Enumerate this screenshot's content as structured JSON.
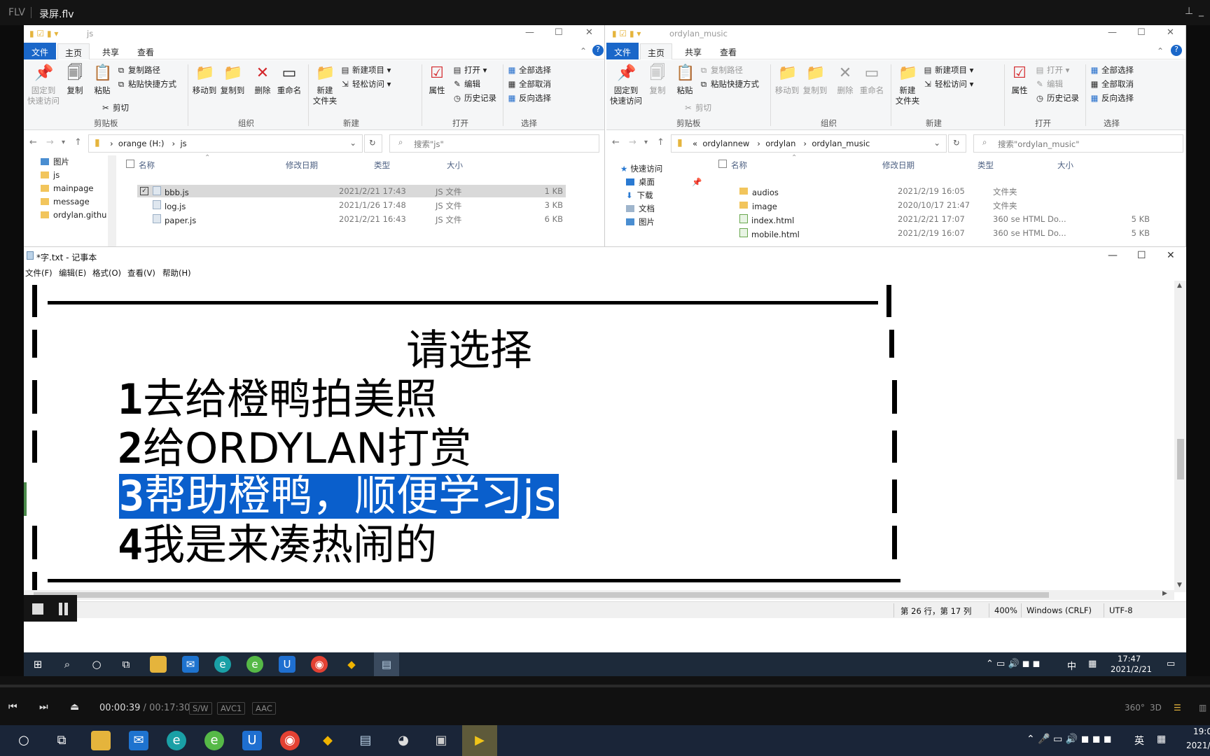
{
  "player_window": {
    "tag": "FLV",
    "filename": "录屏.flv",
    "pin_icon": "pin-icon",
    "minimize_glyph": "_"
  },
  "explorer_left": {
    "title": "js",
    "tabs": [
      "文件",
      "主页",
      "共享",
      "查看"
    ],
    "ribbon": {
      "pin": "固定到\n快速访问",
      "copy": "复制",
      "paste": "粘贴",
      "copy_path": "复制路径",
      "paste_shortcut": "粘贴快捷方式",
      "cut": "剪切",
      "clipboard": "剪贴板",
      "move_to": "移动到",
      "copy_to": "复制到",
      "delete": "删除",
      "rename": "重命名",
      "organize": "组织",
      "new_folder": "新建\n文件夹",
      "new_item": "新建项目",
      "easy_access": "轻松访问",
      "new_group": "新建",
      "properties": "属性",
      "open": "打开",
      "edit": "编辑",
      "history": "历史记录",
      "open_group": "打开",
      "select_all": "全部选择",
      "select_none": "全部取消",
      "invert": "反向选择",
      "select_group": "选择"
    },
    "path": [
      "orange (H:)",
      "js"
    ],
    "search_placeholder": "搜索\"js\"",
    "nav": [
      "图片",
      "js",
      "mainpage",
      "message",
      "ordylan.github.io"
    ],
    "columns": {
      "name": "名称",
      "date": "修改日期",
      "type": "类型",
      "size": "大小"
    },
    "files": [
      {
        "name": "bbb.js",
        "date": "2021/2/21 17:43",
        "type": "JS 文件",
        "size": "1 KB"
      },
      {
        "name": "log.js",
        "date": "2021/1/26 17:48",
        "type": "JS 文件",
        "size": "3 KB"
      },
      {
        "name": "paper.js",
        "date": "2021/2/21 16:43",
        "type": "JS 文件",
        "size": "6 KB"
      }
    ]
  },
  "explorer_right": {
    "title": "ordylan_music",
    "path": [
      "ordylannew",
      "ordylan",
      "ordylan_music"
    ],
    "search_placeholder": "搜索\"ordylan_music\"",
    "nav": [
      "快速访问",
      "桌面",
      "下载",
      "文档",
      "图片"
    ],
    "files": [
      {
        "name": "audios",
        "date": "2021/2/19 16:05",
        "type": "文件夹",
        "size": ""
      },
      {
        "name": "image",
        "date": "2020/10/17 21:47",
        "type": "文件夹",
        "size": ""
      },
      {
        "name": "index.html",
        "date": "2021/2/21 17:07",
        "type": "360 se HTML Do...",
        "size": "5 KB"
      },
      {
        "name": "mobile.html",
        "date": "2021/2/19 16:07",
        "type": "360 se HTML Do...",
        "size": "5 KB"
      }
    ]
  },
  "notepad": {
    "title": "*字.txt - 记事本",
    "menu": [
      "文件(F)",
      "编辑(E)",
      "格式(O)",
      "查看(V)",
      "帮助(H)"
    ],
    "heading": "请选择",
    "options": [
      {
        "num": "1",
        "text": "去给橙鸭拍美照"
      },
      {
        "num": "2",
        "text": "给ORDYLAN打赏"
      },
      {
        "num": "3",
        "text": "帮助橙鸭，顺便学习js"
      },
      {
        "num": "4",
        "text": "我是来凑热闹的"
      }
    ],
    "status": {
      "position": "第 26 行，第 17 列",
      "zoom": "400%",
      "eol": "Windows (CRLF)",
      "encoding": "UTF-8"
    }
  },
  "inner_taskbar": {
    "time": "17:47",
    "date": "2021/2/21",
    "ime": "中"
  },
  "player": {
    "current": "00:00:39",
    "separator": "/",
    "total": "00:17:30",
    "badges": [
      "S/W",
      "AVC1",
      "AAC"
    ],
    "right": [
      "360°",
      "3D"
    ]
  },
  "host_taskbar": {
    "ime": "英",
    "time": "19:0",
    "date": "2021/"
  }
}
